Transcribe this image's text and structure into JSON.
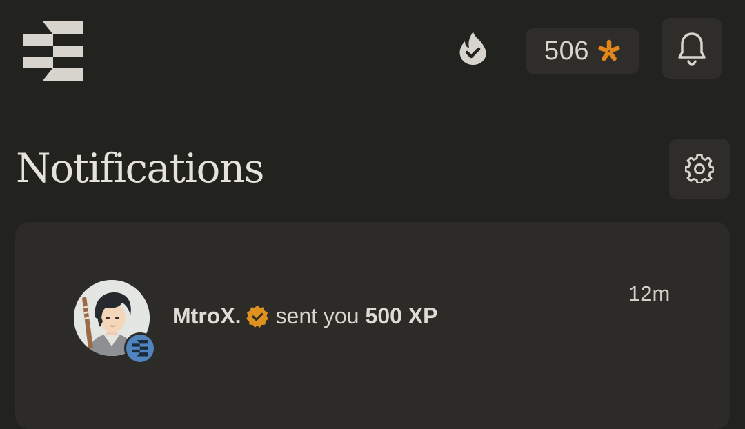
{
  "header": {
    "logo_icon": "stacked-bars-logo",
    "streak_icon": "flame-check-icon",
    "xp": {
      "value": "506",
      "icon": "asterisk-star-icon",
      "color": "#e0861a"
    },
    "notifications_icon": "bell-icon"
  },
  "page": {
    "title": "Notifications",
    "settings_icon": "gear-icon"
  },
  "notifications": [
    {
      "user": "MtroX.",
      "verified_icon": "verified-badge-icon",
      "verified_color": "#e0921f",
      "action": "sent you",
      "amount": "500 XP",
      "time": "12m",
      "avatar_badge_color": "#4f84bf"
    }
  ]
}
